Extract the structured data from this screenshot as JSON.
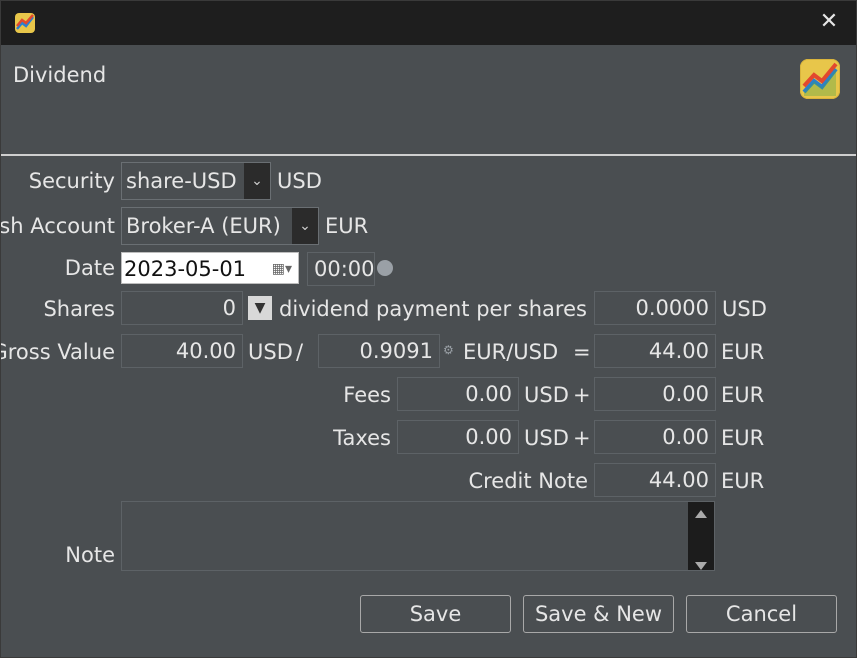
{
  "window": {
    "close_label": "✕"
  },
  "header": {
    "title": "Dividend"
  },
  "form": {
    "security": {
      "label": "Security",
      "value": "share-USD",
      "currency": "USD"
    },
    "cash_account": {
      "label": "sh Account",
      "value": "Broker-A (EUR)",
      "currency": "EUR"
    },
    "date": {
      "label": "Date",
      "value": "2023-05-01",
      "time": "00:00"
    },
    "shares": {
      "label": "Shares",
      "value": "0",
      "per_share_label": "dividend payment per shares",
      "per_share_value": "0.0000",
      "per_share_currency": "USD"
    },
    "gross": {
      "label": "Gross Value",
      "value": "40.00",
      "currency": "USD",
      "divider": "/",
      "rate": "0.9091",
      "rate_unit": "EUR/USD",
      "equals": "=",
      "converted": "44.00",
      "converted_currency": "EUR"
    },
    "fees": {
      "label": "Fees",
      "value": "0.00",
      "currency": "USD",
      "plus": "+",
      "converted": "0.00",
      "converted_currency": "EUR"
    },
    "taxes": {
      "label": "Taxes",
      "value": "0.00",
      "currency": "USD",
      "plus": "+",
      "converted": "0.00",
      "converted_currency": "EUR"
    },
    "credit_note": {
      "label": "Credit Note",
      "value": "44.00",
      "currency": "EUR"
    },
    "note": {
      "label": "Note",
      "value": ""
    }
  },
  "buttons": {
    "save": "Save",
    "save_new": "Save & New",
    "cancel": "Cancel"
  },
  "colors": {
    "background": "#4a4e51",
    "titlebar": "#1e1e1e",
    "text": "#e6e6e6",
    "logo": "#e8c64a"
  }
}
